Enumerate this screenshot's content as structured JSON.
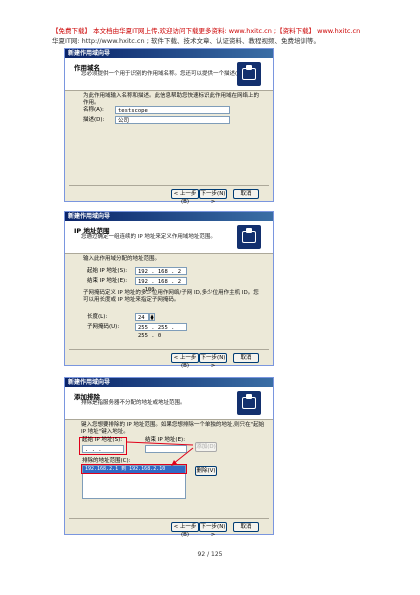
{
  "header": {
    "line1": "【免费下载】 本文档由华夏IT网上传,欢迎访问下载更多资料: www.hxitc.cn ;【资料下载】 www.hxitc.cn",
    "line2": "华夏IT网: http://www.hxitc.cn  ;  软件下载、技术文章、认证资料、教程视频、免费培训等。"
  },
  "dialog1": {
    "title": "新建作用域向导",
    "section_title": "作用域名",
    "section_sub": "您必须提供一个用于识别的作用域名称。您还可以提供一个描述(可选)。",
    "instruction": "为此作用域输入名称和描述。此信息帮助您快速标识此作用域在网络上的作用。",
    "name_label": "名称(A):",
    "name_value": "testscope",
    "desc_label": "描述(D):",
    "desc_value": "公司",
    "back": "< 上一步(B)",
    "next": "下一步(N) >",
    "cancel": "取消"
  },
  "dialog2": {
    "title": "新建作用域向导",
    "section_title": "IP 地址范围",
    "section_sub": "您通过确定一组连续的 IP 地址来定义作用域地址范围。",
    "instruction": "输入此作用域分配的地址范围。",
    "start_label": "起始 IP 地址(S):",
    "start_value": "192 . 168 .  2  .  1",
    "end_label": "结束 IP 地址(E):",
    "end_value": "192 . 168 .  2  . 100",
    "mask_text": "子网掩码定义 IP 地址的多少位用作网络/子网 ID,多少位用作主机 ID。您可以用长度或 IP 地址来指定子网掩码。",
    "length_label": "长度(L):",
    "length_value": "24",
    "mask_label": "子网掩码(U):",
    "mask_value": "255 . 255 . 255 .  0",
    "back": "< 上一步(B)",
    "next": "下一步(N) >",
    "cancel": "取消"
  },
  "dialog3": {
    "title": "新建作用域向导",
    "section_title": "添加排除",
    "section_sub": "排除是指服务器不分配的地址或地址范围。",
    "instruction": "键入您想要排除的 IP 地址范围。如果您想排除一个单独的地址,则只在\"起始 IP 地址\"键入地址。",
    "start_label": "起始 IP 地址(S):",
    "start_value": "   .    .    .",
    "end_label": "结束 IP 地址(E):",
    "add": "添加(D)",
    "excluded_label": "排除的地址范围(C):",
    "excluded_item": "192.168.2.1 到 192.168.2.10",
    "remove": "删除(V)",
    "back": "< 上一步(B)",
    "next": "下一步(N) >",
    "cancel": "取消"
  },
  "footer": {
    "page": "92 / 125"
  }
}
